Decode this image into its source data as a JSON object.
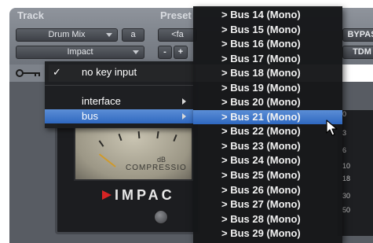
{
  "plugin_header": {
    "track_label": "Track",
    "preset_label": "Preset",
    "track_name": "Drum Mix",
    "track_slot": "a",
    "insert_name": "Impact",
    "preset_field": "<fa",
    "minus_label": "-",
    "plus_label": "+",
    "bypass_label": "BYPAS",
    "format_label": "TDM"
  },
  "impact": {
    "meter_db_label": "dB",
    "meter_text": "COMPRESSIO",
    "logo_text": "IMPAC"
  },
  "meter_scale": [
    "0",
    "3",
    "6",
    "10",
    "18",
    "30",
    "50"
  ],
  "context_menu": {
    "items": [
      {
        "label": "no key input",
        "checked": true,
        "check_mark": "✓"
      },
      {
        "label": "interface",
        "submenu": true
      },
      {
        "label": "bus",
        "submenu": true,
        "selected": true
      }
    ]
  },
  "bus_submenu": {
    "items": [
      "> Bus 14 (Mono)",
      "> Bus 15 (Mono)",
      "> Bus 16 (Mono)",
      "> Bus 17 (Mono)",
      "> Bus 18 (Mono)",
      "> Bus 19 (Mono)",
      "> Bus 20 (Mono)",
      "> Bus 21 (Mono)",
      "> Bus 22 (Mono)",
      "> Bus 23 (Mono)",
      "> Bus 24 (Mono)",
      "> Bus 25 (Mono)",
      "> Bus 26 (Mono)",
      "> Bus 27 (Mono)",
      "> Bus 28 (Mono)",
      "> Bus 29 (Mono)"
    ],
    "selected_index": 7
  },
  "colors": {
    "menu_highlight": "#2f68c0",
    "menu_background": "#161719",
    "impact_arrow": "#d62424"
  }
}
